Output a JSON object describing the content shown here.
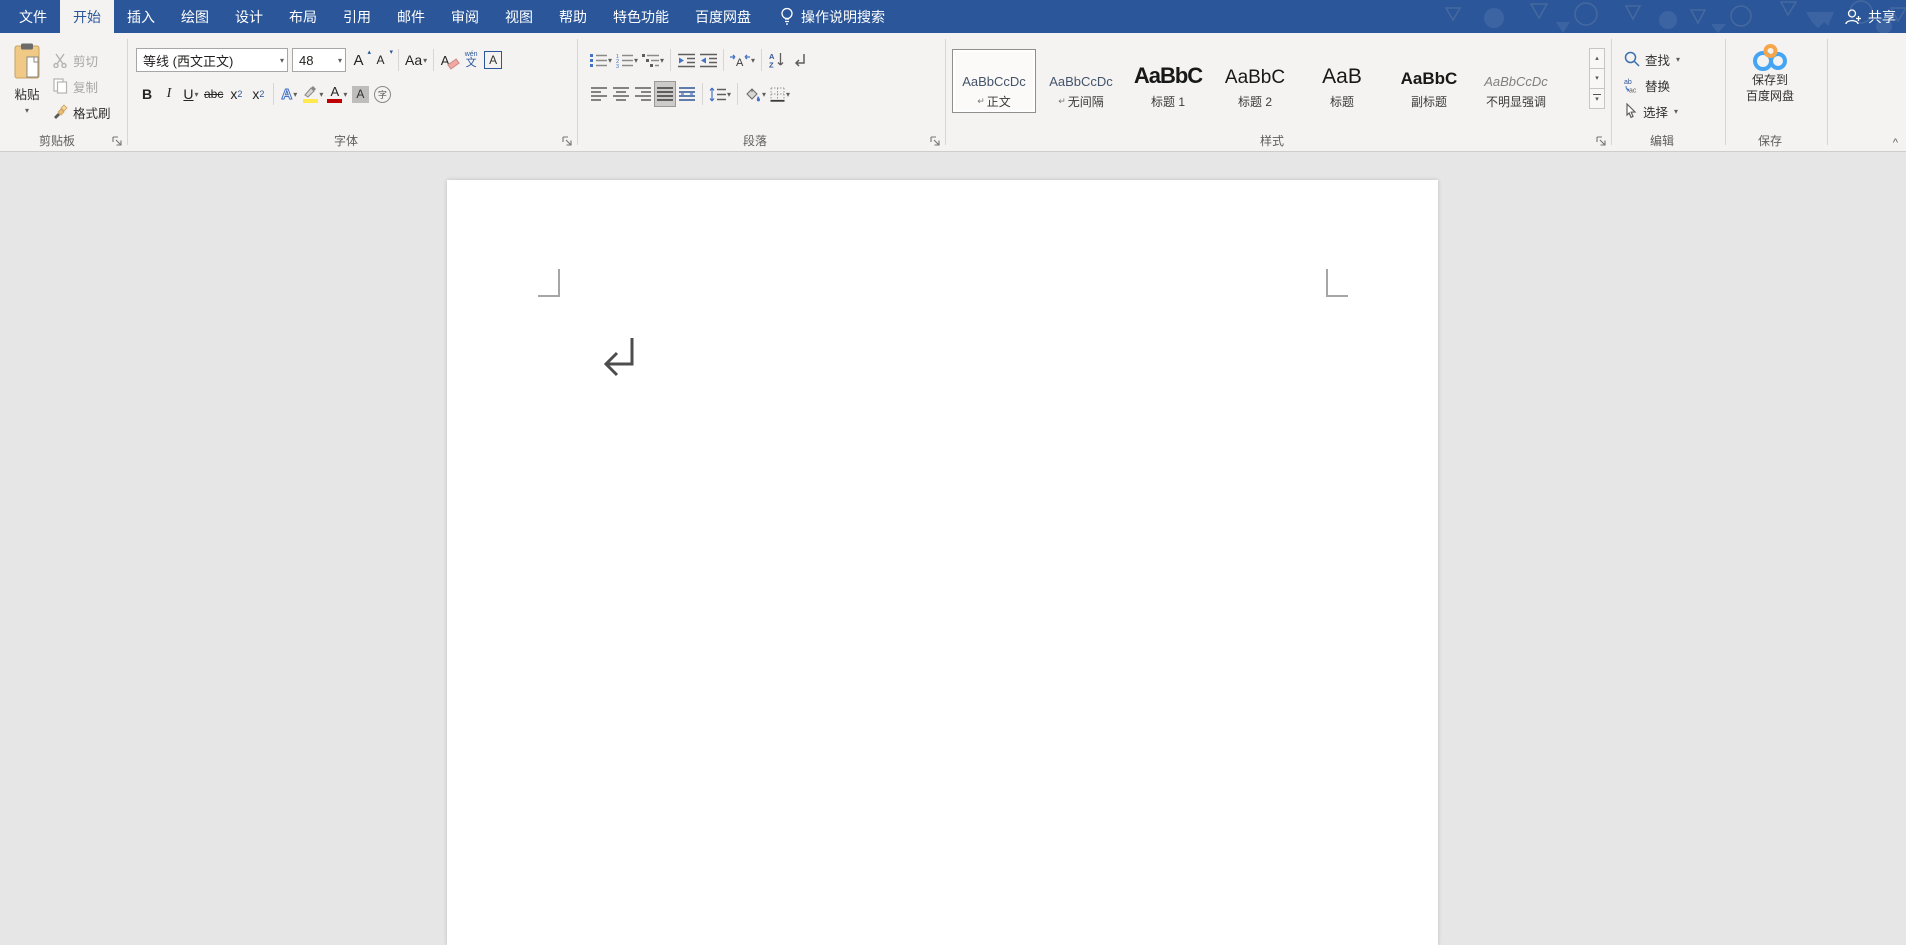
{
  "titlebar": {
    "tabs": [
      {
        "label": "文件",
        "active": false
      },
      {
        "label": "开始",
        "active": true
      },
      {
        "label": "插入",
        "active": false
      },
      {
        "label": "绘图",
        "active": false
      },
      {
        "label": "设计",
        "active": false
      },
      {
        "label": "布局",
        "active": false
      },
      {
        "label": "引用",
        "active": false
      },
      {
        "label": "邮件",
        "active": false
      },
      {
        "label": "审阅",
        "active": false
      },
      {
        "label": "视图",
        "active": false
      },
      {
        "label": "帮助",
        "active": false
      },
      {
        "label": "特色功能",
        "active": false
      },
      {
        "label": "百度网盘",
        "active": false
      }
    ],
    "tell_me": "操作说明搜索",
    "share": "共享"
  },
  "ribbon": {
    "clipboard": {
      "label": "剪贴板",
      "paste": "粘贴",
      "cut": "剪切",
      "copy": "复制",
      "format_painter": "格式刷"
    },
    "font": {
      "label": "字体",
      "font_name": "等线 (西文正文)",
      "font_size": "48",
      "grow": "A",
      "shrink": "A",
      "change_case": "Aa",
      "clear_format": "A",
      "phonetic_top": "wén",
      "phonetic_bottom": "文",
      "char_border": "A",
      "bold": "B",
      "italic": "I",
      "underline": "U",
      "strikethrough": "abc",
      "subscript_base": "x",
      "subscript": "2",
      "superscript_base": "x",
      "superscript": "2",
      "text_effects": "A",
      "font_color": "A",
      "char_shading": "A",
      "enclose": "字"
    },
    "paragraph": {
      "label": "段落",
      "sort_a": "A",
      "sort_z": "Z",
      "asian_layout": "A"
    },
    "styles": {
      "label": "样式",
      "items": [
        {
          "preview": "AaBbCcDc",
          "mark": "↵",
          "name": "正文",
          "selected": true
        },
        {
          "preview": "AaBbCcDc",
          "mark": "↵",
          "name": "无间隔",
          "selected": false
        },
        {
          "preview": "AaBbC",
          "mark": "",
          "name": "标题 1",
          "selected": false
        },
        {
          "preview": "AaBbC",
          "mark": "",
          "name": "标题 2",
          "selected": false
        },
        {
          "preview": "AaB",
          "mark": "",
          "name": "标题",
          "selected": false
        },
        {
          "preview": "AaBbC",
          "mark": "",
          "name": "副标题",
          "selected": false
        },
        {
          "preview": "AaBbCcDc",
          "mark": "",
          "name": "不明显强调",
          "selected": false
        }
      ]
    },
    "editing": {
      "label": "编辑",
      "find": "查找",
      "replace": "替换",
      "select": "选择",
      "replace_icon_top": "ab",
      "replace_icon_bottom": "ac"
    },
    "save": {
      "label": "保存",
      "button_lines": [
        "保存到",
        "百度网盘"
      ]
    }
  },
  "icons": {
    "chevron_down": "▾",
    "scroll_up": "▴",
    "scroll_down": "▾",
    "collapse_ribbon": "^",
    "lightbulb_icon": "bulb",
    "share_person_icon": "person-plus",
    "search_icon": "magnifier",
    "select_icon": "cursor-arrow",
    "baidu_netdisk_icon": "three-circles"
  },
  "colors": {
    "titlebar": "#2b579a",
    "ribbon_bg": "#f4f3f2",
    "document_bg": "#e6e6e6",
    "accent_blue": "#2b579a",
    "font_color_red": "#c00000",
    "highlight_yellow": "#ffe94d",
    "clipboard_tan": "#f0c987",
    "baidu_blue": "#44a5f5",
    "baidu_orange": "#f6a64a"
  }
}
